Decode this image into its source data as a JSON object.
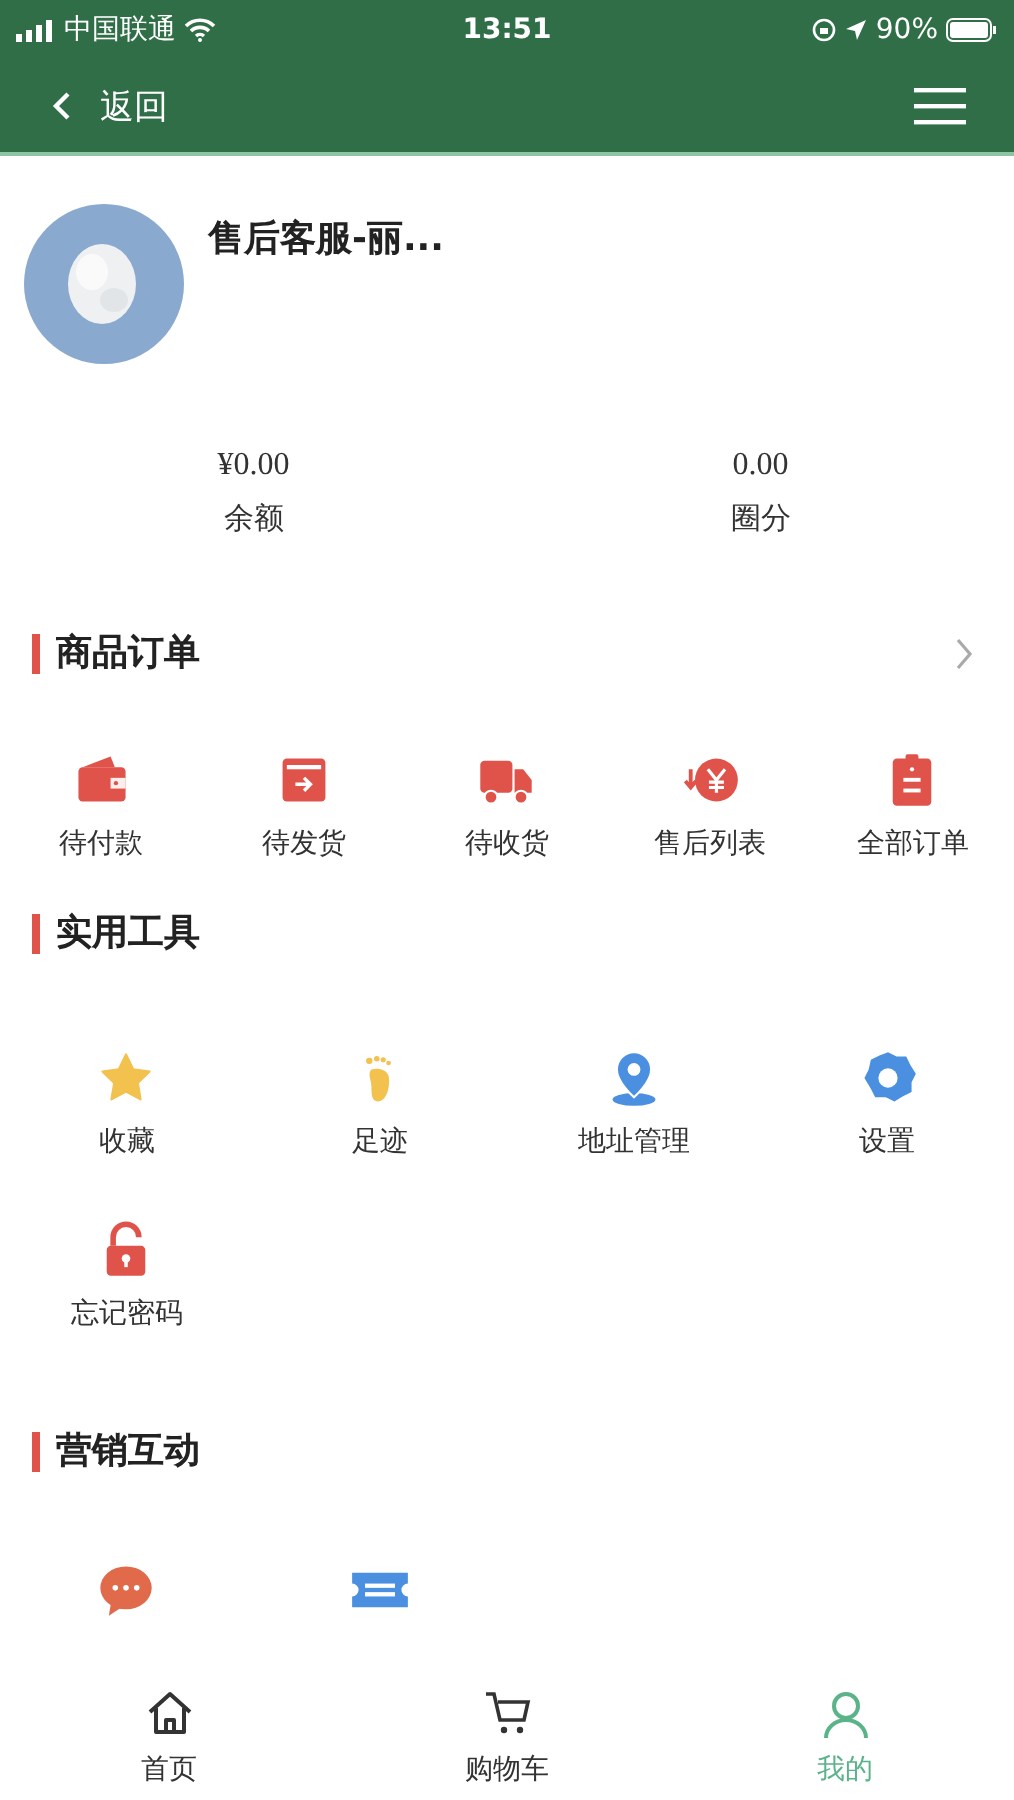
{
  "status_bar": {
    "carrier": "中国联通",
    "time": "13:51",
    "battery": "90%"
  },
  "nav": {
    "back": "返回"
  },
  "profile": {
    "name": "售后客服-丽..."
  },
  "balances": [
    {
      "value": "¥0.00",
      "label": "余额"
    },
    {
      "value": "0.00",
      "label": "圈分"
    }
  ],
  "sections": [
    {
      "title": "商品订单",
      "chevron": true,
      "items": [
        {
          "kind": "labeled",
          "label": "待付款"
        },
        {
          "kind": "labeled",
          "label": "待发货"
        },
        {
          "kind": "labeled",
          "label": "待收货"
        },
        {
          "kind": "labeled",
          "label": "售后列表"
        },
        {
          "kind": "labeled",
          "label": "全部订单"
        }
      ]
    },
    {
      "title": "实用工具",
      "chevron": false,
      "items": [
        {
          "kind": "labeled",
          "label": "收藏"
        },
        {
          "kind": "labeled",
          "label": "足迹"
        },
        {
          "kind": "labeled",
          "label": "地址管理"
        },
        {
          "kind": "labeled",
          "label": "设置"
        },
        {
          "kind": "labeled",
          "label": "忘记密码"
        }
      ]
    },
    {
      "title": "营销互动",
      "chevron": false,
      "items": [
        {
          "kind": "icon-only"
        },
        {
          "kind": "icon-only"
        }
      ]
    }
  ],
  "tabs": [
    {
      "label": "首页",
      "selected": false
    },
    {
      "label": "购物车",
      "selected": false
    },
    {
      "label": "我的",
      "selected": true
    }
  ]
}
